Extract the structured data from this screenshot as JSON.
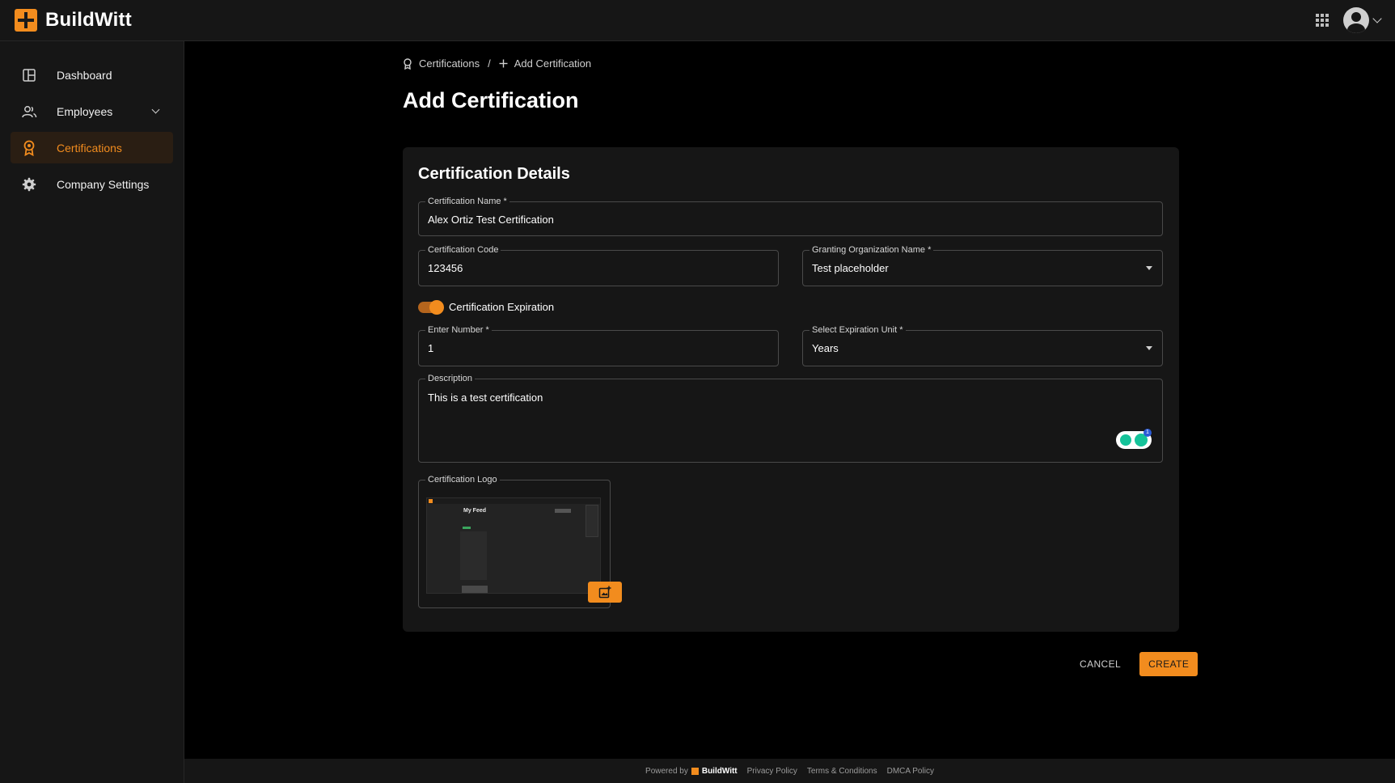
{
  "brand": {
    "name": "BuildWitt"
  },
  "sidebar": {
    "items": [
      {
        "label": "Dashboard",
        "icon": "dashboard-icon",
        "active": false
      },
      {
        "label": "Employees",
        "icon": "users-icon",
        "active": false,
        "expandable": true
      },
      {
        "label": "Certifications",
        "icon": "award-icon",
        "active": true
      },
      {
        "label": "Company Settings",
        "icon": "gear-icon",
        "active": false
      }
    ]
  },
  "breadcrumb": {
    "parent": "Certifications",
    "separator": "/",
    "current": "Add Certification"
  },
  "page": {
    "title": "Add Certification"
  },
  "form": {
    "section_title": "Certification Details",
    "certification_name": {
      "label": "Certification Name *",
      "value": "Alex Ortiz Test Certification"
    },
    "certification_code": {
      "label": "Certification Code",
      "value": "123456"
    },
    "granting_org": {
      "label": "Granting Organization Name *",
      "value": "Test placeholder"
    },
    "expiration_toggle": {
      "label": "Certification Expiration",
      "enabled": true
    },
    "enter_number": {
      "label": "Enter Number *",
      "value": "1"
    },
    "expiration_unit": {
      "label": "Select Expiration Unit *",
      "value": "Years"
    },
    "description": {
      "label": "Description",
      "value": "This is a test certification"
    },
    "logo": {
      "label": "Certification Logo",
      "thumbnail_title": "My Feed"
    },
    "grammarly_badge_count": "1"
  },
  "actions": {
    "cancel": "CANCEL",
    "create": "CREATE"
  },
  "footer": {
    "powered_by": "Powered by",
    "brand": "BuildWitt",
    "links": [
      "Privacy Policy",
      "Terms & Conditions",
      "DMCA Policy"
    ]
  },
  "colors": {
    "accent": "#f28c1e",
    "background": "#000000",
    "surface": "#161616"
  }
}
